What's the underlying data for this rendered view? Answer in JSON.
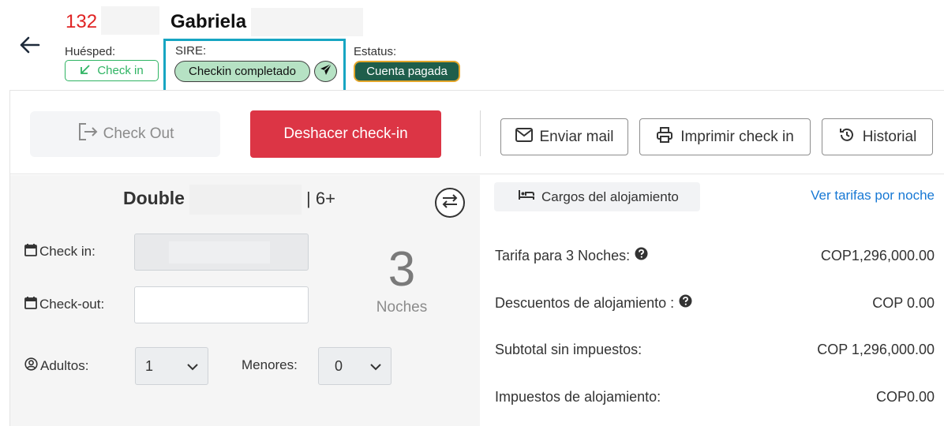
{
  "header": {
    "room_number": "132",
    "guest_name": "Gabriela",
    "guest_label": "Huésped:",
    "guest_status": "Check in",
    "sire_label": "SIRE:",
    "sire_status": "Checkin completado",
    "status_label": "Estatus:",
    "status_value": "Cuenta pagada"
  },
  "actions": {
    "checkout": "Check Out",
    "undo_checkin": "Deshacer check-in",
    "send_mail": "Enviar mail",
    "print_checkin": "Imprimir check in",
    "history": "Historial"
  },
  "stay": {
    "room_type": "Double",
    "occupancy": "| 6+",
    "checkin_label": "Check in:",
    "checkout_label": "Check-out:",
    "checkout_value": "",
    "adults_label": "Adultos:",
    "adults_value": "1",
    "minors_label": "Menores:",
    "minors_value": "0",
    "nights_count": "3",
    "nights_label": "Noches"
  },
  "charges": {
    "tab_label": "Cargos del alojamiento",
    "rates_link": "Ver tarifas por noche",
    "rows": [
      {
        "label": "Tarifa para 3 Noches:",
        "value": "COP1,296,000.00"
      },
      {
        "label": "Descuentos de alojamiento :",
        "value": "COP 0.00"
      },
      {
        "label": "Subtotal sin impuestos:",
        "value": "COP 1,296,000.00"
      },
      {
        "label": "Impuestos de alojamiento:",
        "value": "COP0.00"
      }
    ]
  },
  "colors": {
    "room_number": "#e02424",
    "checkin_green": "#2fb463",
    "sire_highlight": "#17a5c2",
    "status_bg": "#1f5e4b",
    "status_border": "#e4a62b",
    "danger": "#dc3545",
    "link": "#1778d4"
  },
  "icons": [
    "back-arrow-icon",
    "arrow-down-left-icon",
    "send-icon",
    "logout-icon",
    "mail-icon",
    "printer-icon",
    "history-icon",
    "swap-icon",
    "calendar-icon",
    "user-circle-icon",
    "chevron-down-icon",
    "bed-icon",
    "help-icon"
  ]
}
